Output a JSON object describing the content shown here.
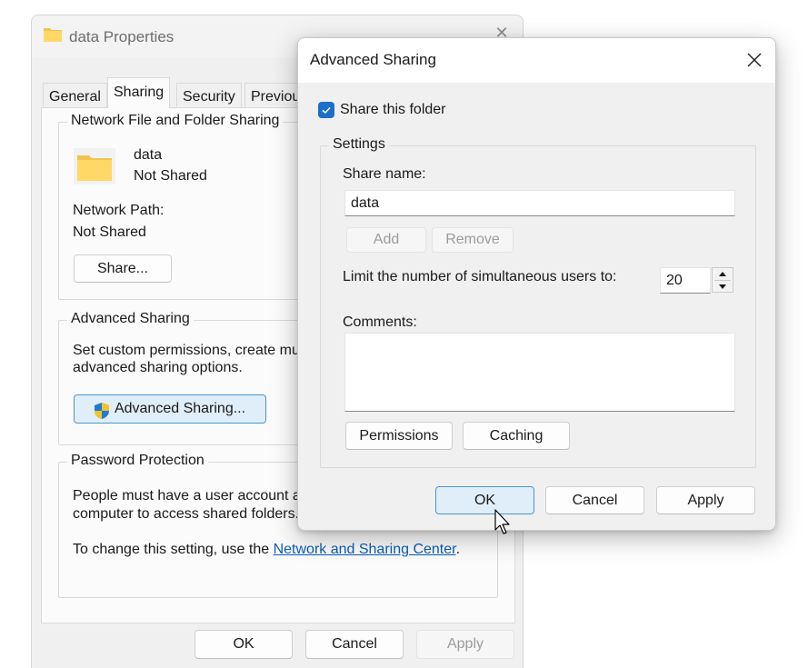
{
  "properties_window": {
    "title": "data Properties",
    "title_icon": "folder-icon",
    "close_icon": "close-icon",
    "tabs": [
      {
        "label": "General",
        "active": false
      },
      {
        "label": "Sharing",
        "active": true
      },
      {
        "label": "Security",
        "active": false
      },
      {
        "label": "Previous Versions",
        "active": false
      }
    ],
    "network_sharing": {
      "legend": "Network File and Folder Sharing",
      "folder_name": "data",
      "folder_status": "Not Shared",
      "network_path_label": "Network Path:",
      "network_path_value": "Not Shared",
      "share_button": "Share..."
    },
    "advanced_sharing": {
      "legend": "Advanced Sharing",
      "description_line1": "Set custom permissions, create multiple shares, and set other",
      "description_line2": "advanced sharing options.",
      "button": "Advanced Sharing...",
      "button_icon": "uac-shield-icon"
    },
    "password_protection": {
      "legend": "Password Protection",
      "description_line1": "People must have a user account and password for this",
      "description_line2": "computer to access shared folders.",
      "change_text": "To change this setting, use the ",
      "link_text": "Network and Sharing Center",
      "link_suffix": "."
    },
    "buttons": {
      "ok": "OK",
      "cancel": "Cancel",
      "apply": "Apply"
    }
  },
  "advanced_sharing_dialog": {
    "title": "Advanced Sharing",
    "close_icon": "close-icon",
    "share_checkbox": {
      "label": "Share this folder",
      "checked": true
    },
    "settings": {
      "legend": "Settings",
      "share_name_label": "Share name:",
      "share_name_value": "data",
      "add_button": "Add",
      "remove_button": "Remove",
      "limit_label": "Limit the number of simultaneous users to:",
      "limit_value": "20",
      "comments_label": "Comments:",
      "comments_value": "",
      "permissions_button": "Permissions",
      "caching_button": "Caching"
    },
    "buttons": {
      "ok": "OK",
      "cancel": "Cancel",
      "apply": "Apply"
    }
  }
}
